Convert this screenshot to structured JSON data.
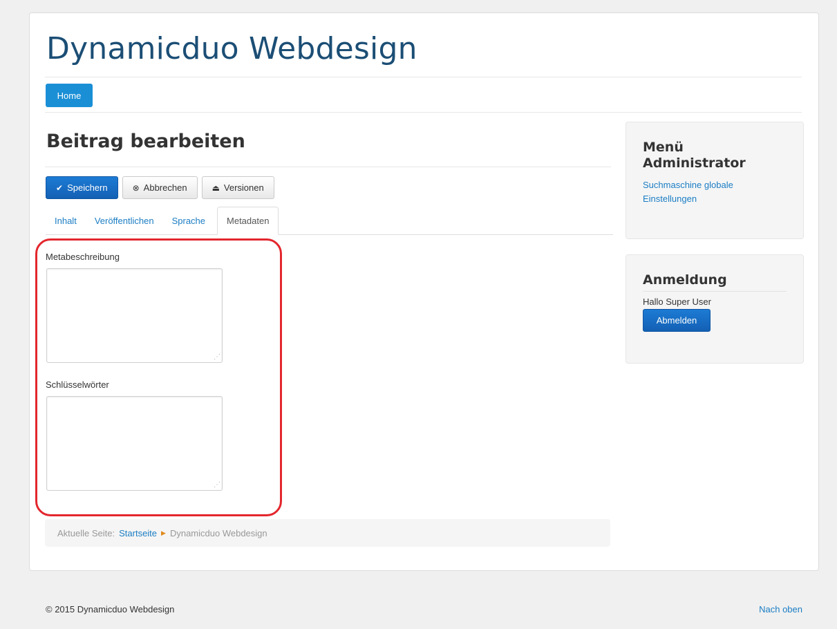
{
  "site": {
    "title": "Dynamicduo Webdesign"
  },
  "nav": {
    "home_label": "Home"
  },
  "main": {
    "heading": "Beitrag bearbeiten",
    "toolbar": {
      "save_label": "Speichern",
      "cancel_label": "Abbrechen",
      "versions_label": "Versionen"
    },
    "tabs": [
      {
        "label": "Inhalt",
        "active": false
      },
      {
        "label": "Veröffentlichen",
        "active": false
      },
      {
        "label": "Sprache",
        "active": false
      },
      {
        "label": "Metadaten",
        "active": true
      }
    ],
    "fields": {
      "meta_description_label": "Metabeschreibung",
      "meta_description_value": "",
      "keywords_label": "Schlüsselwörter",
      "keywords_value": ""
    },
    "breadcrumb": {
      "prefix": "Aktuelle Seite:",
      "items": [
        "Startseite",
        "Dynamicduo Webdesign"
      ]
    }
  },
  "sidebar": {
    "admin_menu": {
      "title": "Menü Administrator",
      "link": "Suchmaschine globale Einstellungen"
    },
    "login": {
      "title": "Anmeldung",
      "greeting": "Hallo Super User",
      "logout_label": "Abmelden"
    }
  },
  "footer": {
    "copyright": "© 2015 Dynamicduo Webdesign",
    "back_to_top": "Nach oben"
  },
  "colors": {
    "brand_title": "#1b4e75",
    "primary_button": "#1360b4",
    "link": "#1b7dc4",
    "highlight": "#e3262d"
  }
}
